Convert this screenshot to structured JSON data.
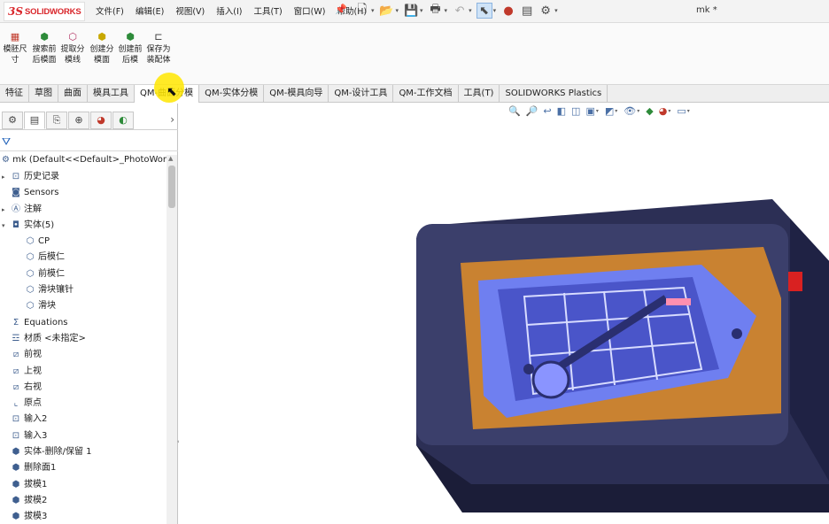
{
  "app": {
    "logo_ds": "3S",
    "logo_text": "SOLIDWORKS",
    "document_title": "mk *"
  },
  "menu": {
    "items": [
      "文件(F)",
      "编辑(E)",
      "视图(V)",
      "插入(I)",
      "工具(T)",
      "窗口(W)",
      "帮助(H)"
    ]
  },
  "command_manager": {
    "buttons": [
      {
        "line1": "模胚尺",
        "line2": "寸",
        "icon": "mold-base-size-icon",
        "color": "#c0392b"
      },
      {
        "line1": "搜索前",
        "line2": "后模面",
        "icon": "search-faces-icon",
        "color": "#2e8b3a"
      },
      {
        "line1": "提取分",
        "line2": "模线",
        "icon": "extract-parting-line-icon",
        "color": "#b03060"
      },
      {
        "line1": "创建分",
        "line2": "模面",
        "icon": "create-parting-surface-icon",
        "color": "#c8a800"
      },
      {
        "line1": "创建前",
        "line2": "后模",
        "icon": "create-core-cavity-icon",
        "color": "#2e8b3a"
      },
      {
        "line1": "保存为",
        "line2": "装配体",
        "icon": "save-as-assembly-icon",
        "color": "#333333"
      }
    ]
  },
  "tabs": [
    "特征",
    "草图",
    "曲面",
    "模具工具",
    "QM-曲面分模",
    "QM-实体分模",
    "QM-模具向导",
    "QM-设计工具",
    "QM-工作文档",
    "工具(T)",
    "SOLIDWORKS Plastics"
  ],
  "active_tab": 4,
  "feature_tree": {
    "root": "mk  (Default<<Default>_PhotoWorks Di",
    "nodes": [
      {
        "label": "历史记录",
        "indent": 0,
        "expander": "▸",
        "icon": "history-icon"
      },
      {
        "label": "Sensors",
        "indent": 0,
        "expander": "",
        "icon": "sensors-icon"
      },
      {
        "label": "注解",
        "indent": 0,
        "expander": "▸",
        "icon": "annotations-icon"
      },
      {
        "label": "实体(5)",
        "indent": 0,
        "expander": "▾",
        "icon": "solid-bodies-icon"
      },
      {
        "label": "CP",
        "indent": 1,
        "expander": "",
        "icon": "body-icon"
      },
      {
        "label": "后模仁",
        "indent": 1,
        "expander": "",
        "icon": "body-icon"
      },
      {
        "label": "前模仁",
        "indent": 1,
        "expander": "",
        "icon": "body-icon"
      },
      {
        "label": "滑块镶针",
        "indent": 1,
        "expander": "",
        "icon": "body-icon"
      },
      {
        "label": "滑块",
        "indent": 1,
        "expander": "",
        "icon": "body-icon"
      },
      {
        "label": "Equations",
        "indent": 0,
        "expander": "",
        "icon": "equations-icon"
      },
      {
        "label": "材质 <未指定>",
        "indent": 0,
        "expander": "",
        "icon": "material-icon"
      },
      {
        "label": "前视",
        "indent": 0,
        "expander": "",
        "icon": "plane-icon"
      },
      {
        "label": "上视",
        "indent": 0,
        "expander": "",
        "icon": "plane-icon"
      },
      {
        "label": "右视",
        "indent": 0,
        "expander": "",
        "icon": "plane-icon"
      },
      {
        "label": "原点",
        "indent": 0,
        "expander": "",
        "icon": "origin-icon"
      },
      {
        "label": "输入2",
        "indent": 0,
        "expander": "",
        "icon": "import-icon"
      },
      {
        "label": "输入3",
        "indent": 0,
        "expander": "",
        "icon": "import-icon"
      },
      {
        "label": "实体-删除/保留 1",
        "indent": 0,
        "expander": "",
        "icon": "delete-body-icon"
      },
      {
        "label": "删除面1",
        "indent": 0,
        "expander": "",
        "icon": "delete-face-icon"
      },
      {
        "label": "拔模1",
        "indent": 0,
        "expander": "",
        "icon": "draft-icon"
      },
      {
        "label": "拔模2",
        "indent": 0,
        "expander": "",
        "icon": "draft-icon"
      },
      {
        "label": "拔模3",
        "indent": 0,
        "expander": "",
        "icon": "draft-icon"
      }
    ]
  },
  "colors": {
    "accent": "#1d5fb8",
    "brand": "#d9262b",
    "model_body": "#3b3f6b",
    "model_orange": "#d98a2b",
    "model_blue": "#6f7ff0",
    "cursor_highlight": "#ffe600"
  }
}
